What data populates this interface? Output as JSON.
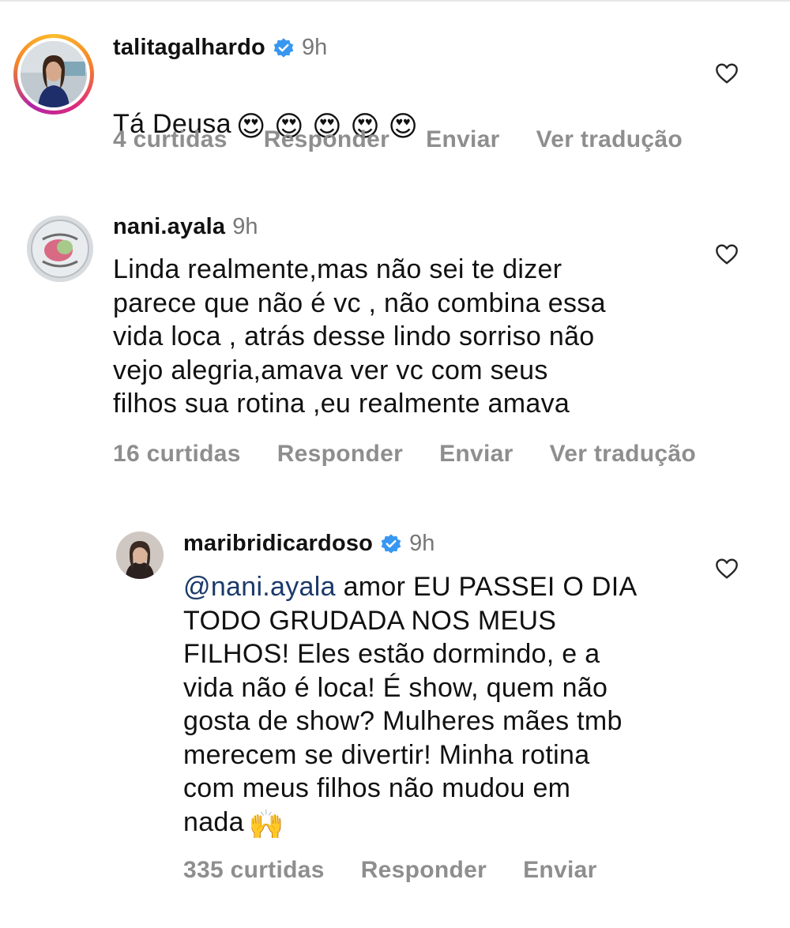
{
  "comments": [
    {
      "username": "talitagalhardo",
      "verified": true,
      "time": "9h",
      "text": "Tá Deusa",
      "emojis": "😍 😍 😍 😍 😍",
      "likes": "4 curtidas",
      "reply": "Responder",
      "send": "Enviar",
      "translate": "Ver tradução"
    },
    {
      "username": "nani.ayala",
      "verified": false,
      "time": "9h",
      "text": "Linda realmente,mas não sei te dizer\nparece que não é vc , não combina essa\nvida loca , atrás desse lindo sorriso não\nvejo alegria,amava ver vc com seus\nfilhos sua rotina ,eu realmente amava",
      "likes": "16 curtidas",
      "reply": "Responder",
      "send": "Enviar",
      "translate": "Ver tradução"
    },
    {
      "username": "maribridicardoso",
      "verified": true,
      "time": "9h",
      "mention": "@nani.ayala",
      "text": " amor EU PASSEI O DIA\nTODO GRUDADA NOS MEUS\nFILHOS! Eles estão dormindo, e a\nvida não é loca! É show, quem não\ngosta de show? Mulheres mães tmb\nmerecem se divertir! Minha rotina\ncom meus filhos não mudou em\nnada",
      "emoji": "🙌",
      "likes": "335 curtidas",
      "reply": "Responder",
      "send": "Enviar"
    }
  ],
  "colors": {
    "verified": "#3897f0",
    "muted": "#8e8e8e",
    "mention": "#1b3a6b"
  },
  "icons": {
    "verified": "verified-badge-icon",
    "like": "heart-outline-icon"
  }
}
